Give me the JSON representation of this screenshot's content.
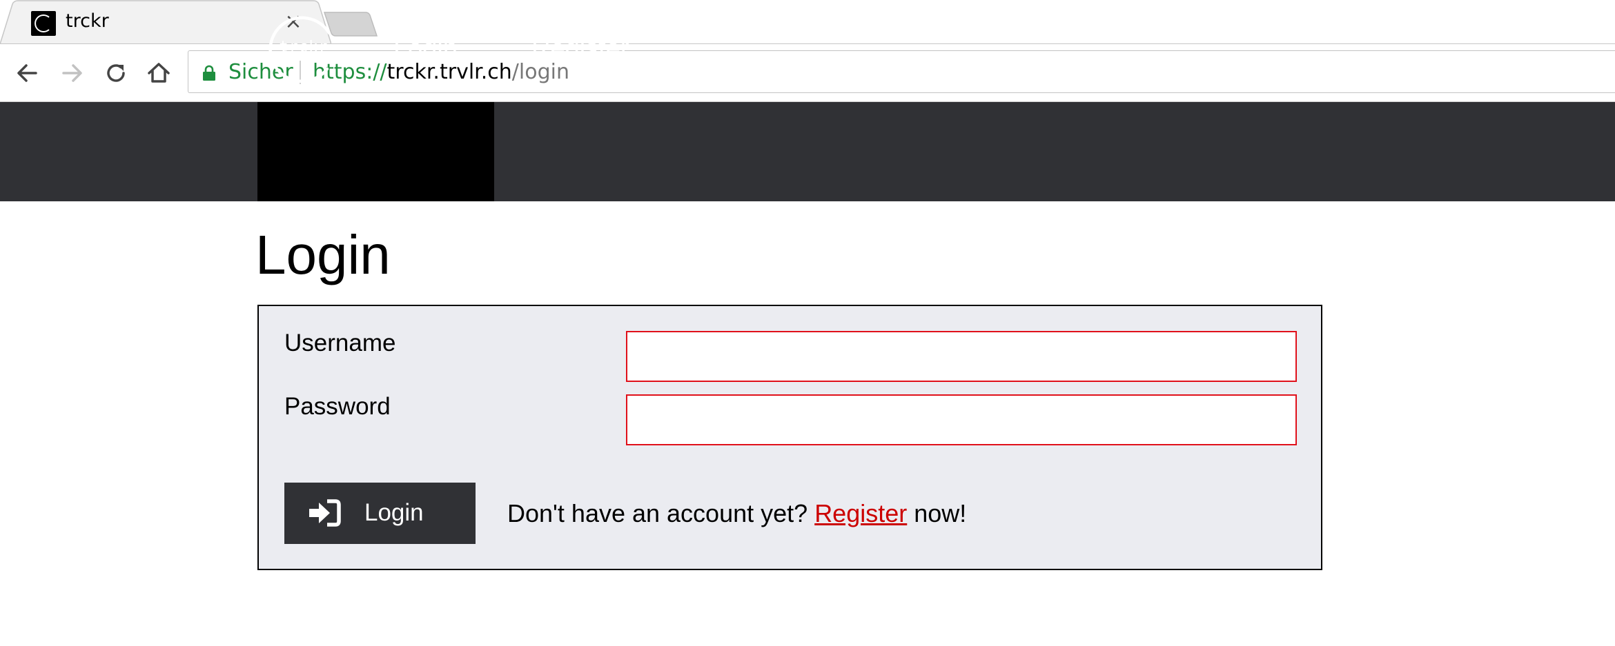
{
  "browser": {
    "tab": {
      "title": "trckr",
      "close_glyph": "×",
      "favicon": "trckr-logo-icon"
    },
    "toolbar": {
      "back_icon": "arrow-left-icon",
      "forward_icon": "arrow-right-icon",
      "reload_icon": "reload-icon",
      "home_icon": "home-icon"
    },
    "omnibox": {
      "secure_label": "Sicher",
      "url_scheme": "https://",
      "url_host": "trckr.trvlr.ch",
      "url_path": "/login"
    }
  },
  "site": {
    "logo_text": "trckr",
    "nav": {
      "login": "Login",
      "register": "Register"
    }
  },
  "page": {
    "title": "Login",
    "form": {
      "username_label": "Username",
      "username_value": "",
      "password_label": "Password",
      "password_value": "",
      "submit_label": "Login",
      "register_prompt": "Don't have an account yet?",
      "register_link": "Register",
      "register_suffix": "now!"
    }
  },
  "colors": {
    "header_bg": "#303135",
    "active_nav_bg": "#000000",
    "panel_bg": "#ebecf1",
    "input_border": "#e0101a",
    "link": "#cc0000",
    "secure_green": "#1e8e3e"
  }
}
